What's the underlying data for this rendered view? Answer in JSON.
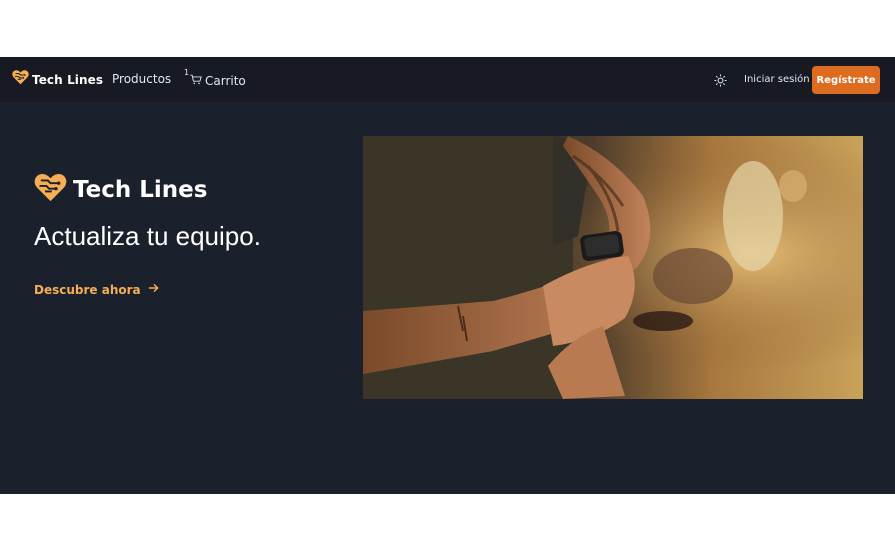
{
  "navbar": {
    "brand": "Tech Lines",
    "products_label": "Productos",
    "cart_count": "1",
    "cart_label": "Carrito",
    "theme_icon": "sun-icon",
    "login_label": "Iniciar sesión",
    "signup_label": "Regístrate"
  },
  "hero": {
    "brand": "Tech Lines",
    "tagline": "Actualiza tu equipo.",
    "cta_label": "Descubre ahora",
    "cta_icon": "arrow-right-icon",
    "image": "smartwatch-photo"
  },
  "colors": {
    "accent": "#dd6b20",
    "accent_light": "#f6ad55",
    "background": "#1a202c",
    "navbar": "#171923"
  }
}
